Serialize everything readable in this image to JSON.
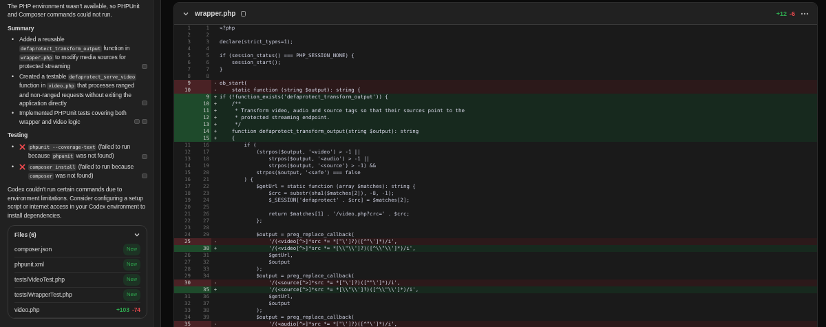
{
  "sidebar": {
    "intro": "The PHP environment wasn't available, so PHPUnit and Composer commands could not run.",
    "summary_heading": "Summary",
    "summary_items": [
      {
        "bullet": "•",
        "segments": [
          {
            "kind": "text",
            "t": "Added a reusable "
          },
          {
            "kind": "code",
            "t": "defaprotect_transform_output"
          },
          {
            "kind": "text",
            "t": " function in "
          },
          {
            "kind": "code",
            "t": "wrapper.php"
          },
          {
            "kind": "text",
            "t": " to modify media sources for protected streaming"
          },
          {
            "kind": "cite"
          }
        ]
      },
      {
        "bullet": "•",
        "segments": [
          {
            "kind": "text",
            "t": "Created a testable "
          },
          {
            "kind": "code",
            "t": "defaprotect_serve_video"
          },
          {
            "kind": "text",
            "t": " function in "
          },
          {
            "kind": "code",
            "t": "video.php"
          },
          {
            "kind": "text",
            "t": " that processes ranged and non-ranged requests without exiting the application directly"
          },
          {
            "kind": "cite"
          }
        ]
      },
      {
        "bullet": "•",
        "segments": [
          {
            "kind": "text",
            "t": "Implemented PHPUnit tests covering both wrapper and video logic"
          },
          {
            "kind": "cite"
          },
          {
            "kind": "cite"
          }
        ]
      }
    ],
    "testing_heading": "Testing",
    "testing_items": [
      {
        "bullet": "•",
        "segments": [
          {
            "kind": "fail"
          },
          {
            "kind": "code",
            "t": "phpunit --coverage-text"
          },
          {
            "kind": "text",
            "t": " (failed to run because "
          },
          {
            "kind": "code",
            "t": "phpunit"
          },
          {
            "kind": "text",
            "t": " was not found)"
          },
          {
            "kind": "cite"
          }
        ]
      },
      {
        "bullet": "•",
        "segments": [
          {
            "kind": "fail"
          },
          {
            "kind": "code",
            "t": "composer install"
          },
          {
            "kind": "text",
            "t": " (failed to run because "
          },
          {
            "kind": "code",
            "t": "composer"
          },
          {
            "kind": "text",
            "t": " was not found)"
          },
          {
            "kind": "cite"
          }
        ]
      }
    ],
    "note": "Codex couldn't run certain commands due to environment limitations. Consider configuring a setup script or internet access in your Codex environment to install dependencies.",
    "files": {
      "title": "Files (6)",
      "expanded": true,
      "items": [
        {
          "name": "composer.json",
          "kind": "new",
          "badge": "New"
        },
        {
          "name": "phpunit.xml",
          "kind": "new",
          "badge": "New"
        },
        {
          "name": "tests/VideoTest.php",
          "kind": "new",
          "badge": "New"
        },
        {
          "name": "tests/WrapperTest.php",
          "kind": "new",
          "badge": "New"
        },
        {
          "name": "video.php",
          "kind": "changed",
          "added": "+103",
          "removed": "-74"
        }
      ]
    }
  },
  "diff": {
    "filename": "wrapper.php",
    "expanded": true,
    "added": "+12",
    "removed": "-6",
    "rows": [
      {
        "kind": "ctx",
        "old": "1",
        "new": "1",
        "code": "<?php"
      },
      {
        "kind": "ctx",
        "old": "2",
        "new": "2"
      },
      {
        "kind": "ctx",
        "old": "3",
        "new": "3",
        "code": "declare(strict_types=1);"
      },
      {
        "kind": "ctx",
        "old": "4",
        "new": "4"
      },
      {
        "kind": "ctx",
        "old": "5",
        "new": "5",
        "code": "if (session_status() === PHP_SESSION_NONE) {"
      },
      {
        "kind": "ctx",
        "old": "6",
        "new": "6",
        "code": "    session_start();"
      },
      {
        "kind": "ctx",
        "old": "7",
        "new": "7",
        "code": "}"
      },
      {
        "kind": "ctx",
        "old": "8",
        "new": "8"
      },
      {
        "kind": "del",
        "old": "9",
        "sign": "-",
        "code": "ob_start("
      },
      {
        "kind": "del",
        "old": "10",
        "sign": "-",
        "code": "    static function (string $output): string {"
      },
      {
        "kind": "add",
        "new": "9",
        "sign": "+",
        "code": "if (!function_exists('defaprotect_transform_output')) {"
      },
      {
        "kind": "add",
        "new": "10",
        "sign": "+",
        "code": "    /**"
      },
      {
        "kind": "add",
        "new": "11",
        "sign": "+",
        "code": "     * Transform video, audio and source tags so that their sources point to the"
      },
      {
        "kind": "add",
        "new": "12",
        "sign": "+",
        "code": "     * protected streaming endpoint."
      },
      {
        "kind": "add",
        "new": "13",
        "sign": "+",
        "code": "     */"
      },
      {
        "kind": "add",
        "new": "14",
        "sign": "+",
        "code": "    function defaprotect_transform_output(string $output): string"
      },
      {
        "kind": "add",
        "new": "15",
        "sign": "+",
        "code": "    {"
      },
      {
        "kind": "ctx",
        "old": "11",
        "new": "16",
        "code": "        if ("
      },
      {
        "kind": "ctx",
        "old": "12",
        "new": "17",
        "code": "            (strpos($output, '<video') > -1 ||"
      },
      {
        "kind": "ctx",
        "old": "13",
        "new": "18",
        "code": "                strpos($output, '<audio') > -1 ||"
      },
      {
        "kind": "ctx",
        "old": "14",
        "new": "19",
        "code": "                strpos($output, '<source') > -1) &&"
      },
      {
        "kind": "ctx",
        "old": "15",
        "new": "20",
        "code": "            strpos($output, '<safe') === false"
      },
      {
        "kind": "ctx",
        "old": "16",
        "new": "21",
        "code": "        ) {"
      },
      {
        "kind": "ctx",
        "old": "17",
        "new": "22",
        "code": "            $getUrl = static function (array $matches): string {"
      },
      {
        "kind": "ctx",
        "old": "18",
        "new": "23",
        "code": "                $crc = substr(sha1($matches[2]), -8, -1);"
      },
      {
        "kind": "ctx",
        "old": "19",
        "new": "24",
        "code": "                $_SESSION['defaprotect' . $crc] = $matches[2];"
      },
      {
        "kind": "ctx",
        "old": "20",
        "new": "25"
      },
      {
        "kind": "ctx",
        "old": "21",
        "new": "26",
        "code": "                return $matches[1] . '/video.php?crc=' . $crc;"
      },
      {
        "kind": "ctx",
        "old": "22",
        "new": "27",
        "code": "            };"
      },
      {
        "kind": "ctx",
        "old": "23",
        "new": "28"
      },
      {
        "kind": "ctx",
        "old": "24",
        "new": "29",
        "code": "            $output = preg_replace_callback("
      },
      {
        "kind": "del",
        "old": "25",
        "sign": "-",
        "code": "                '/(<video[^>]*src *= *[\"\\']?)([^\"\\']*)/i',"
      },
      {
        "kind": "add",
        "new": "30",
        "sign": "+",
        "code": "                '/(<video[^>]*src *= *[\\\\\"\\\\']?)([^\\\\\"\\\\']*)/i',"
      },
      {
        "kind": "ctx",
        "old": "26",
        "new": "31",
        "code": "                $getUrl,"
      },
      {
        "kind": "ctx",
        "old": "27",
        "new": "32",
        "code": "                $output"
      },
      {
        "kind": "ctx",
        "old": "28",
        "new": "33",
        "code": "            );"
      },
      {
        "kind": "ctx",
        "old": "29",
        "new": "34",
        "code": "            $output = preg_replace_callback("
      },
      {
        "kind": "del",
        "old": "30",
        "sign": "-",
        "code": "                '/(<source[^>]*src *= *[\"\\']?)([^\"\\']*)/i',"
      },
      {
        "kind": "add",
        "new": "35",
        "sign": "+",
        "code": "                '/(<source[^>]*src *= *[\\\\\"\\\\']?)([^\\\\\"\\\\']*)/i',"
      },
      {
        "kind": "ctx",
        "old": "31",
        "new": "36",
        "code": "                $getUrl,"
      },
      {
        "kind": "ctx",
        "old": "32",
        "new": "37",
        "code": "                $output"
      },
      {
        "kind": "ctx",
        "old": "33",
        "new": "38",
        "code": "            );"
      },
      {
        "kind": "ctx",
        "old": "34",
        "new": "39",
        "code": "            $output = preg_replace_callback("
      },
      {
        "kind": "del",
        "old": "35",
        "sign": "-",
        "code": "                '/(<audio[^>]*src *= *[\"\\']?)([^\"\\']*)/i',"
      }
    ]
  }
}
